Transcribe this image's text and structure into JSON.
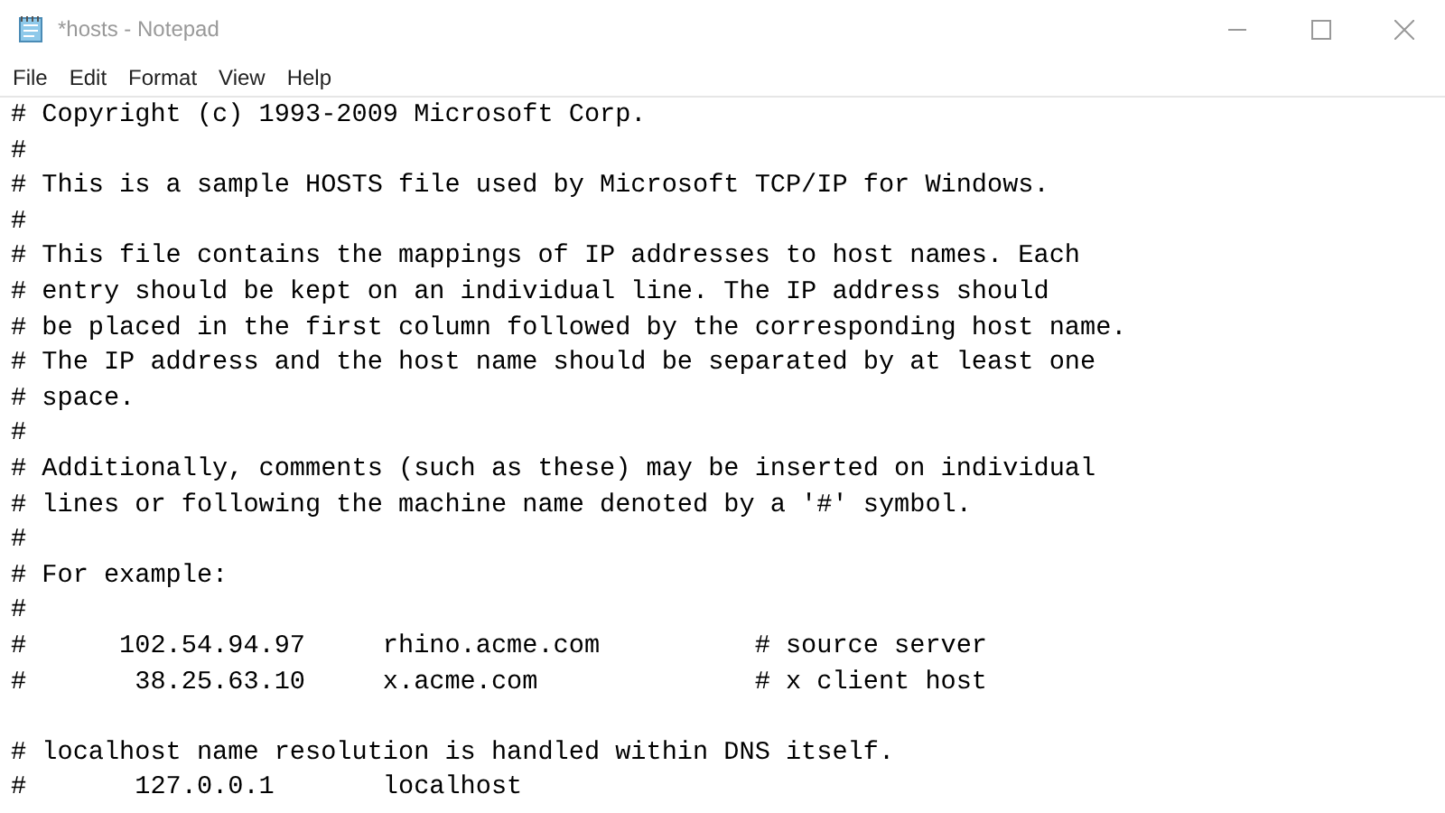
{
  "window": {
    "title": "*hosts - Notepad"
  },
  "menu": [
    "File",
    "Edit",
    "Format",
    "View",
    "Help"
  ],
  "editor": {
    "blocks": [
      [
        "# Copyright (c) 1993-2009 Microsoft Corp.",
        "#",
        "# This is a sample HOSTS file used by Microsoft TCP/IP for Windows.",
        "#",
        "# This file contains the mappings of IP addresses to host names. Each",
        "# entry should be kept on an individual line. The IP address should",
        "# be placed in the first column followed by the corresponding host name.",
        "# The IP address and the host name should be separated by at least one",
        "# space.",
        "#",
        "# Additionally, comments (such as these) may be inserted on individual",
        "# lines or following the machine name denoted by a '#' symbol.",
        "#",
        "# For example:",
        "#",
        "#      102.54.94.97     rhino.acme.com          # source server",
        "#       38.25.63.10     x.acme.com              # x client host"
      ],
      [
        "# localhost name resolution is handled within DNS itself.",
        "#       127.0.0.1       localhost"
      ]
    ]
  }
}
